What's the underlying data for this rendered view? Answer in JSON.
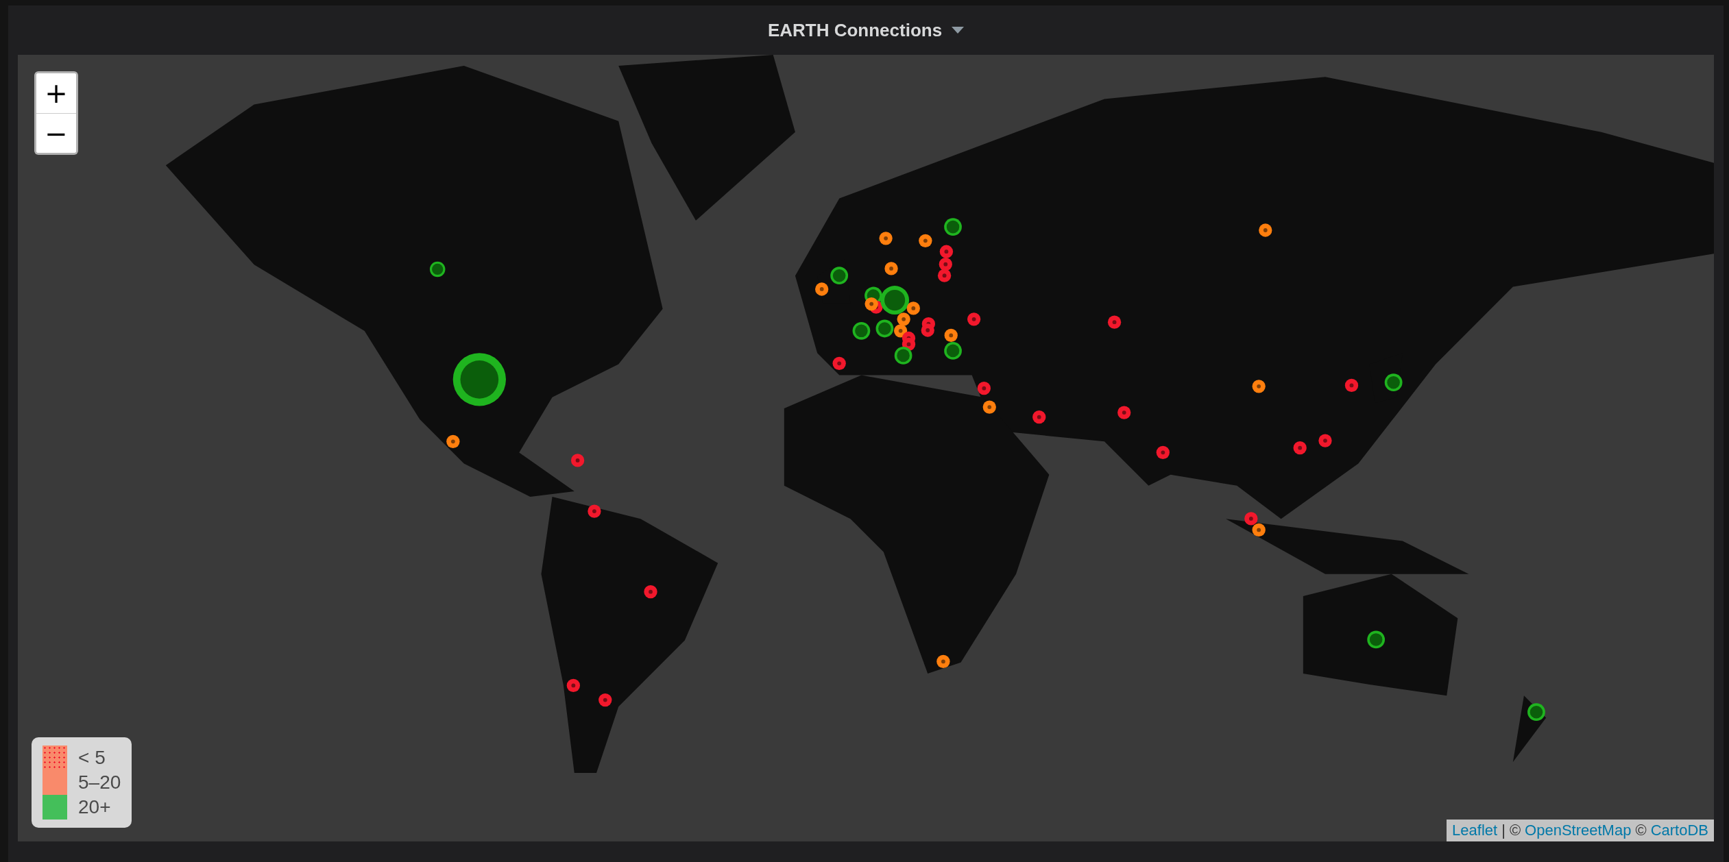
{
  "panel": {
    "title": "EARTH Connections"
  },
  "zoom_controls": [
    "+",
    "−"
  ],
  "markers": [
    {
      "color": "#1fb41f",
      "kind": "small"
    },
    {
      "color": "#1fb41f",
      "kind": "xlarge"
    },
    {
      "color": "#ff7f0e",
      "kind": "tiny"
    },
    {
      "color": "#f2182c",
      "kind": "tiny"
    },
    {
      "color": "#f2182c",
      "kind": "tiny"
    },
    {
      "color": "#f2182c",
      "kind": "tiny"
    },
    {
      "color": "#f2182c",
      "kind": "tiny"
    },
    {
      "color": "#f2182c",
      "kind": "tiny"
    },
    {
      "color": "#ff7f0e",
      "kind": "tiny"
    },
    {
      "color": "#1fb41f",
      "kind": "medium"
    },
    {
      "color": "#ff7f0e",
      "kind": "tiny"
    },
    {
      "color": "#ff7f0e",
      "kind": "tiny"
    },
    {
      "color": "#1fb41f",
      "kind": "medium"
    },
    {
      "color": "#ff7f0e",
      "kind": "tiny"
    },
    {
      "color": "#f2182c",
      "kind": "tiny"
    },
    {
      "color": "#f2182c",
      "kind": "tiny"
    },
    {
      "color": "#f2182c",
      "kind": "tiny"
    },
    {
      "color": "#1fb41f",
      "kind": "medium"
    },
    {
      "color": "#f2182c",
      "kind": "tiny"
    },
    {
      "color": "#1fb41f",
      "kind": "large"
    },
    {
      "color": "#ff7f0e",
      "kind": "tiny"
    },
    {
      "color": "#1fb41f",
      "kind": "medium"
    },
    {
      "color": "#1fb41f",
      "kind": "medium"
    },
    {
      "color": "#ff7f0e",
      "kind": "tiny"
    },
    {
      "color": "#ff7f0e",
      "kind": "tiny"
    },
    {
      "color": "#f2182c",
      "kind": "tiny"
    },
    {
      "color": "#f2182c",
      "kind": "tiny"
    },
    {
      "color": "#ff7f0e",
      "kind": "tiny"
    },
    {
      "color": "#f2182c",
      "kind": "tiny"
    },
    {
      "color": "#f2182c",
      "kind": "tiny"
    },
    {
      "color": "#1fb41f",
      "kind": "medium"
    },
    {
      "color": "#1fb41f",
      "kind": "medium"
    },
    {
      "color": "#ff7f0e",
      "kind": "tiny"
    },
    {
      "color": "#f2182c",
      "kind": "tiny"
    },
    {
      "color": "#f2182c",
      "kind": "tiny"
    },
    {
      "color": "#f2182c",
      "kind": "tiny"
    },
    {
      "color": "#ff7f0e",
      "kind": "tiny"
    },
    {
      "color": "#ff7f0e",
      "kind": "tiny"
    },
    {
      "color": "#f2182c",
      "kind": "tiny"
    },
    {
      "color": "#f2182c",
      "kind": "tiny"
    },
    {
      "color": "#f2182c",
      "kind": "tiny"
    },
    {
      "color": "#f2182c",
      "kind": "tiny"
    },
    {
      "color": "#ff7f0e",
      "kind": "tiny"
    },
    {
      "color": "#f2182c",
      "kind": "tiny"
    },
    {
      "color": "#1fb41f",
      "kind": "medium"
    },
    {
      "color": "#f2182c",
      "kind": "tiny"
    },
    {
      "color": "#f2182c",
      "kind": "tiny"
    },
    {
      "color": "#f2182c",
      "kind": "tiny"
    },
    {
      "color": "#ff7f0e",
      "kind": "tiny"
    },
    {
      "color": "#1fb41f",
      "kind": "medium"
    },
    {
      "color": "#1fb41f",
      "kind": "medium"
    },
    {
      "color": "#ff7f0e",
      "kind": "tiny"
    }
  ],
  "legend": [
    {
      "label": "< 5",
      "color": "#f98a6b",
      "dotted": true
    },
    {
      "label": "5–20",
      "color": "#f98a6b",
      "dotted": false
    },
    {
      "label": "20+",
      "color": "#44bf5a",
      "dotted": false
    }
  ],
  "attribution": [
    {
      "kind": "link",
      "text": "Leaflet"
    },
    {
      "kind": "text",
      "text": "|"
    },
    {
      "kind": "text",
      "text": "©"
    },
    {
      "kind": "link",
      "text": "OpenStreetMap"
    },
    {
      "kind": "text",
      "text": "©"
    },
    {
      "kind": "link",
      "text": "CartoDB"
    }
  ]
}
